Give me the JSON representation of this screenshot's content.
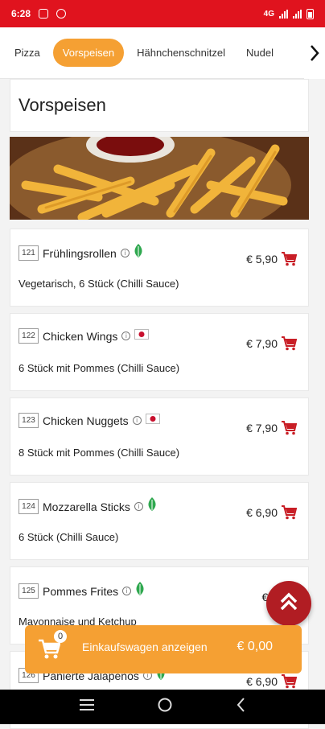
{
  "status": {
    "time": "6:28",
    "network": "4G"
  },
  "tabs": [
    {
      "label": "Pizza",
      "active": false
    },
    {
      "label": "Vorspeisen",
      "active": true
    },
    {
      "label": "Hähnchenschnitzel",
      "active": false
    },
    {
      "label": "Nudel",
      "active": false
    }
  ],
  "section": {
    "title": "Vorspeisen"
  },
  "items": [
    {
      "number": "121",
      "name": "Frühlingsrollen",
      "tag": "vegetarian-leaf-icon",
      "description": "Vegetarisch, 6 Stück (Chilli Sauce)",
      "price": "€ 5,90"
    },
    {
      "number": "122",
      "name": "Chicken Wings",
      "tag": "japan-flag-icon",
      "description": "6 Stück mit Pommes (Chilli Sauce)",
      "price": "€ 7,90"
    },
    {
      "number": "123",
      "name": "Chicken Nuggets",
      "tag": "japan-flag-icon",
      "description": "8 Stück mit Pommes (Chilli Sauce)",
      "price": "€ 7,90"
    },
    {
      "number": "124",
      "name": "Mozzarella Sticks",
      "tag": "vegetarian-leaf-icon",
      "description": "6 Stück (Chilli Sauce)",
      "price": "€ 6,90"
    },
    {
      "number": "125",
      "name": "Pommes Frites",
      "tag": "vegetarian-leaf-icon",
      "description": "Mayonnaise und Ketchup",
      "price": "€ 4"
    },
    {
      "number": "126",
      "name": "Panierte Jalapeños",
      "tag": "vegetarian-leaf-icon",
      "description": "",
      "price": "€ 6,90"
    }
  ],
  "cart": {
    "count": "0",
    "label": "Einkaufswagen anzeigen",
    "total": "€ 0,00"
  },
  "colors": {
    "statusbar": "#e0131e",
    "accent": "#f5a033",
    "cart_icon": "#c81d25",
    "fab": "#b11d23",
    "leaf": "#2fa84f"
  }
}
